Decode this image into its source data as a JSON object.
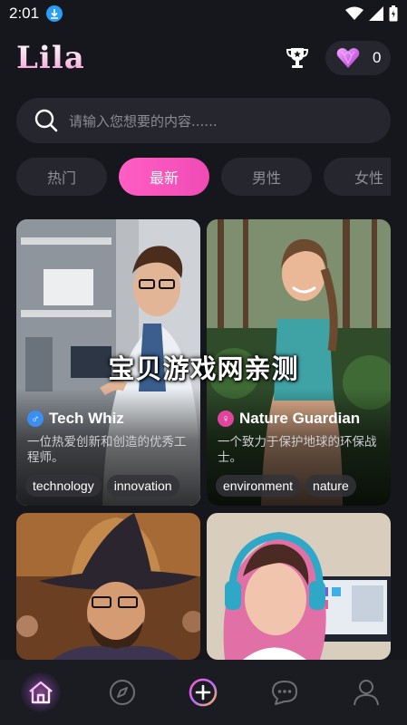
{
  "status": {
    "time": "2:01"
  },
  "app": {
    "logo": "Lila"
  },
  "wallet": {
    "gem_count": "0"
  },
  "search": {
    "placeholder": "请输入您想要的内容......"
  },
  "tabs": [
    {
      "label": "热门",
      "active": false
    },
    {
      "label": "最新",
      "active": true
    },
    {
      "label": "男性",
      "active": false
    },
    {
      "label": "女性",
      "active": false
    }
  ],
  "cards": [
    {
      "name": "Tech Whiz",
      "gender": "male",
      "description": "一位热爱创新和创造的优秀工程师。",
      "tags": [
        "technology",
        "innovation"
      ]
    },
    {
      "name": "Nature Guardian",
      "gender": "female",
      "description": "一个致力于保护地球的环保战士。",
      "tags": [
        "environment",
        "nature"
      ]
    },
    {
      "name": "",
      "gender": "",
      "description": "",
      "tags": []
    },
    {
      "name": "",
      "gender": "",
      "description": "",
      "tags": []
    }
  ],
  "watermark": "宝贝游戏网亲测",
  "colors": {
    "accent_pink": "#f04bb5",
    "male_badge": "#3a8ff0",
    "female_badge": "#e0459d",
    "background": "#16171d"
  },
  "nav": {
    "items": [
      {
        "icon": "home-icon",
        "active": true
      },
      {
        "icon": "compass-icon",
        "active": false
      },
      {
        "icon": "add-icon",
        "active": false
      },
      {
        "icon": "chat-icon",
        "active": false
      },
      {
        "icon": "profile-icon",
        "active": false
      }
    ]
  }
}
